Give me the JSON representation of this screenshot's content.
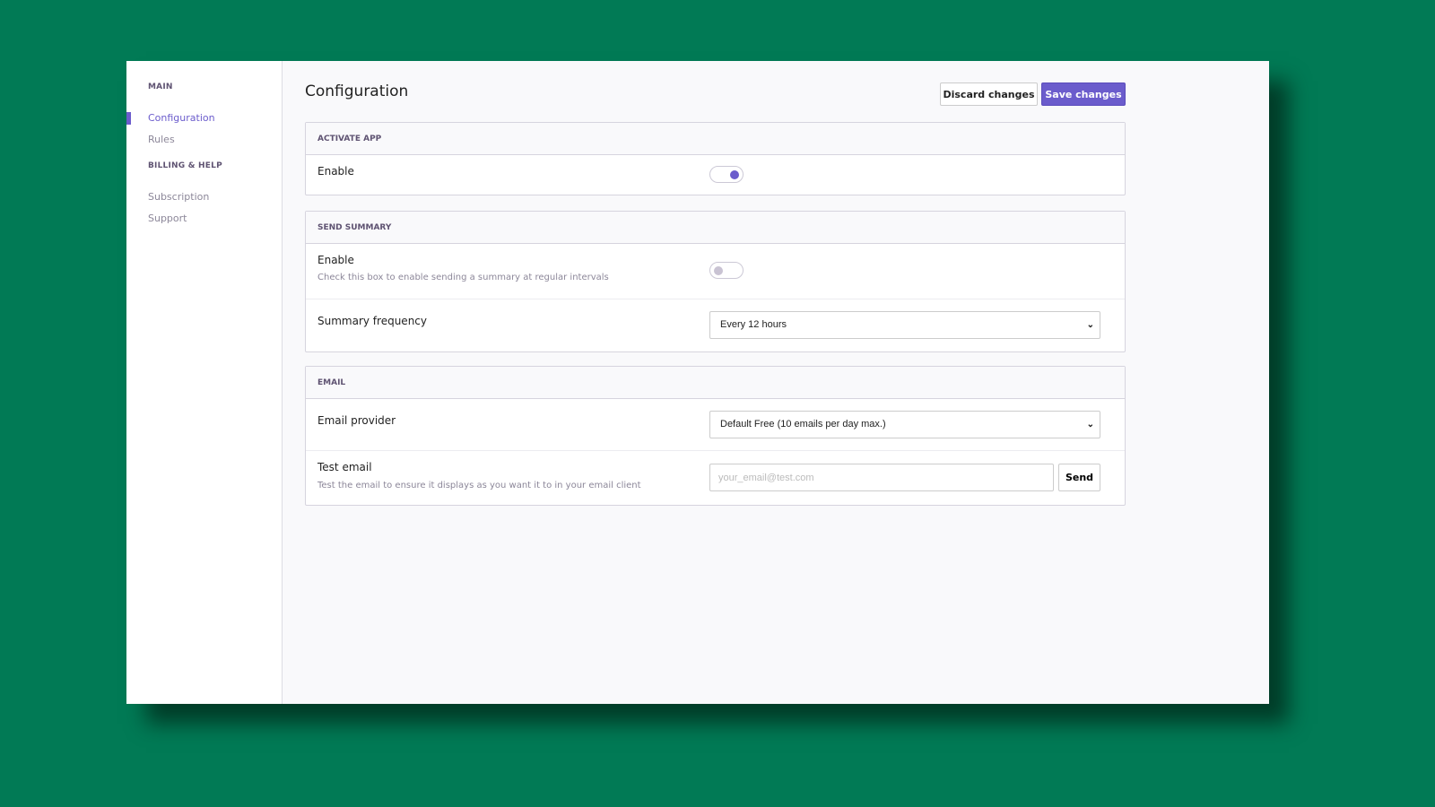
{
  "colors": {
    "accent": "#6b5ccc",
    "background": "#017a55"
  },
  "sidebar": {
    "sections": [
      {
        "heading": "MAIN",
        "items": [
          {
            "label": "Configuration",
            "active": true
          },
          {
            "label": "Rules"
          }
        ]
      },
      {
        "heading": "BILLING & HELP",
        "items": [
          {
            "label": "Subscription"
          },
          {
            "label": "Support"
          }
        ]
      }
    ]
  },
  "header": {
    "title": "Configuration",
    "discard_label": "Discard changes",
    "save_label": "Save changes"
  },
  "activate": {
    "heading": "ACTIVATE APP",
    "enable_label": "Enable",
    "enabled": true
  },
  "summary": {
    "heading": "SEND SUMMARY",
    "enable_label": "Enable",
    "enable_desc": "Check this box to enable sending a summary at regular intervals",
    "enabled": false,
    "frequency_label": "Summary frequency",
    "frequency_value": "Every 12 hours"
  },
  "email": {
    "heading": "EMAIL",
    "provider_label": "Email provider",
    "provider_value": "Default Free (10 emails per day max.)",
    "test_label": "Test email",
    "test_desc": "Test the email to ensure it displays as you want it to in your email client",
    "test_placeholder": "your_email@test.com",
    "send_label": "Send"
  }
}
